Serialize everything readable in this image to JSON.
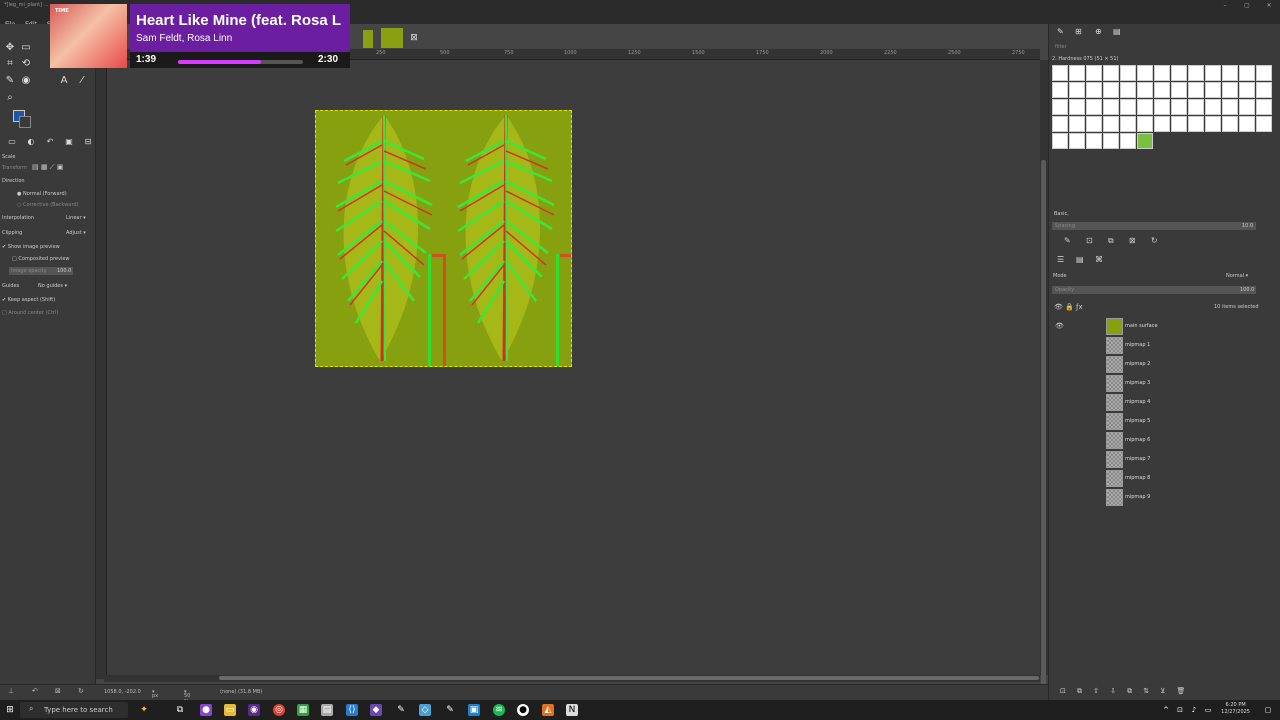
{
  "window": {
    "title": "*[leg_mi_plant] ..."
  },
  "menu": [
    "File",
    "Edit",
    "Sele"
  ],
  "now_playing": {
    "song": "Heart Like Mine (feat. Rosa L",
    "artist": "Sam Feldt, Rosa Linn",
    "time_current": "1:39",
    "time_total": "2:30",
    "progress": 0.66,
    "art_text": "TIME"
  },
  "tool_options": {
    "title": "Scale",
    "transform_label": "Transform",
    "direction_label": "Direction",
    "direction_forward": "Normal (Forward)",
    "direction_backward": "Corrective (Backward)",
    "interpolation_label": "Interpolation",
    "interpolation_value": "Linear",
    "clipping_label": "Clipping",
    "clipping_value": "Adjust",
    "show_preview": "Show image preview",
    "composited_preview": "Composited preview",
    "image_opacity_label": "Image opacity",
    "image_opacity_value": "100.0",
    "guides_label": "Guides",
    "guides_value": "No guides",
    "keep_aspect": "Keep aspect (Shift)",
    "around_center": "Around center (Ctrl)"
  },
  "ruler_labels": [
    "250",
    "500",
    "750",
    "1000",
    "1250",
    "1500",
    "1750",
    "2000",
    "2250",
    "2500",
    "2750"
  ],
  "statusbar": {
    "coords": "1058.0, -202.0",
    "unit": "px",
    "zoom": "50 %",
    "info": "(none) (31.8 MB)"
  },
  "brushes": {
    "filter_placeholder": "filter",
    "current": "2. Hardness 075 (51 × 51)",
    "preset": "Basic,",
    "spacing_label": "Spacing",
    "spacing_value": "10.0"
  },
  "layers": {
    "mode_label": "Mode",
    "mode_value": "Normal",
    "opacity_label": "Opacity",
    "opacity_value": "100.0",
    "selected_text": "10 items selected",
    "items": [
      {
        "name": "main surface"
      },
      {
        "name": "mipmap 1"
      },
      {
        "name": "mipmap 2"
      },
      {
        "name": "mipmap 3"
      },
      {
        "name": "mipmap 4"
      },
      {
        "name": "mipmap 5"
      },
      {
        "name": "mipmap 6"
      },
      {
        "name": "mipmap 7"
      },
      {
        "name": "mipmap 8"
      },
      {
        "name": "mipmap 9"
      }
    ]
  },
  "taskbar": {
    "search_placeholder": "Type here to search",
    "time": "6:20 PM",
    "date": "12/27/2025"
  },
  "colors": {
    "accent": "#6b1fa0",
    "progress": "#d83aff",
    "image_bg": "#87a010",
    "foreground": "#1957a8"
  }
}
